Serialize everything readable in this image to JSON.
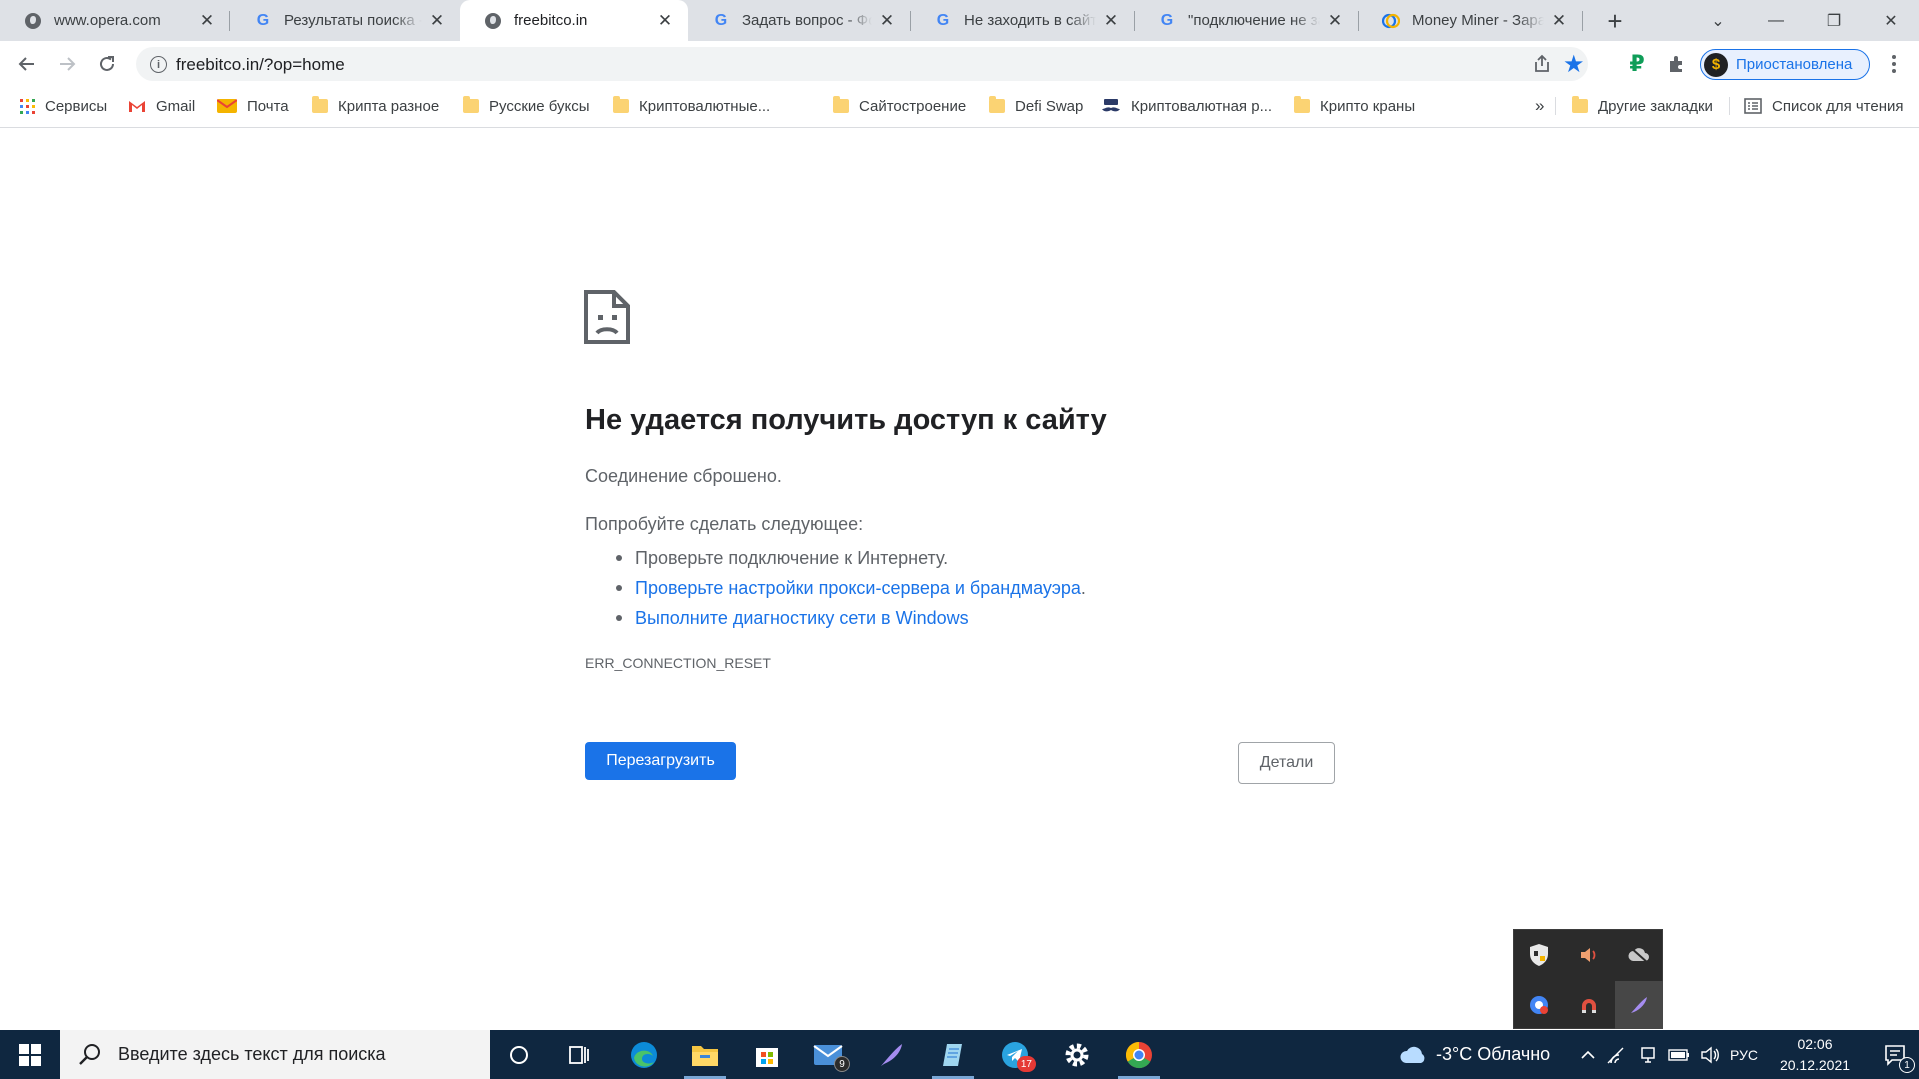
{
  "tabs": [
    {
      "title": "www.opera.com",
      "favicon": "globe-icon",
      "active": false
    },
    {
      "title": "Результаты поиска - ",
      "favicon": "google-icon",
      "active": false
    },
    {
      "title": "freebitco.in",
      "favicon": "globe-icon",
      "active": true
    },
    {
      "title": "Задать вопрос - Фор",
      "favicon": "google-icon",
      "active": false
    },
    {
      "title": "Не заходить в сайт - ",
      "favicon": "google-icon",
      "active": false
    },
    {
      "title": "\"подключение не за",
      "favicon": "google-icon",
      "active": false
    },
    {
      "title": "Money Miner - Зараб",
      "favicon": "money-miner-icon",
      "active": false
    }
  ],
  "tab_close_glyph": "✕",
  "new_tab_glyph": "+",
  "window_controls": {
    "dropdown": "⌄",
    "minimize": "—",
    "restore": "❐",
    "close": "✕"
  },
  "toolbar": {
    "url": "freebitco.in/?op=home",
    "profile_status": "Приостановлена",
    "profile_avatar_glyph": "$",
    "ruble_glyph": "₽"
  },
  "bookmarks": {
    "items": [
      {
        "label": "Сервисы",
        "icon": "apps-grid-icon"
      },
      {
        "label": "Gmail",
        "icon": "gmail-icon"
      },
      {
        "label": "Почта",
        "icon": "mail-icon"
      },
      {
        "label": "Крипта разное",
        "icon": "folder-icon"
      },
      {
        "label": "Русские буксы",
        "icon": "folder-icon"
      },
      {
        "label": "Криптовалютные...",
        "icon": "folder-icon"
      },
      {
        "label": "Сайтостроение",
        "icon": "folder-icon"
      },
      {
        "label": "Defi Swap",
        "icon": "folder-icon"
      },
      {
        "label": "Криптовалютная р...",
        "icon": "mustache-icon"
      },
      {
        "label": "Крипто краны",
        "icon": "folder-icon"
      }
    ],
    "overflow_glyph": "»",
    "other_bookmarks": "Другие закладки",
    "reading_list": "Список для чтения"
  },
  "error_page": {
    "title": "Не удается получить доступ к сайту",
    "description": "Соединение сброшено.",
    "try_label": "Попробуйте сделать следующее:",
    "suggestions": [
      {
        "text": "Проверьте подключение к Интернету.",
        "link": false
      },
      {
        "text": "Проверьте настройки прокси-сервера и брандмауэра",
        "link": true,
        "suffix": "."
      },
      {
        "text": "Выполните диагностику сети в Windows",
        "link": true,
        "suffix": ""
      }
    ],
    "error_code": "ERR_CONNECTION_RESET",
    "reload_label": "Перезагрузить",
    "details_label": "Детали"
  },
  "taskbar": {
    "search_placeholder": "Введите здесь текст для поиска",
    "mail_badge": "9",
    "telegram_badge": "17",
    "weather": "-3°C Облачно",
    "language": "РУС",
    "time": "02:06",
    "date": "20.12.2021",
    "notification_count": "1"
  },
  "colors": {
    "accent": "#1a73e8",
    "tabstrip_bg": "#dee1e6",
    "taskbar_bg": "#0f2740"
  }
}
